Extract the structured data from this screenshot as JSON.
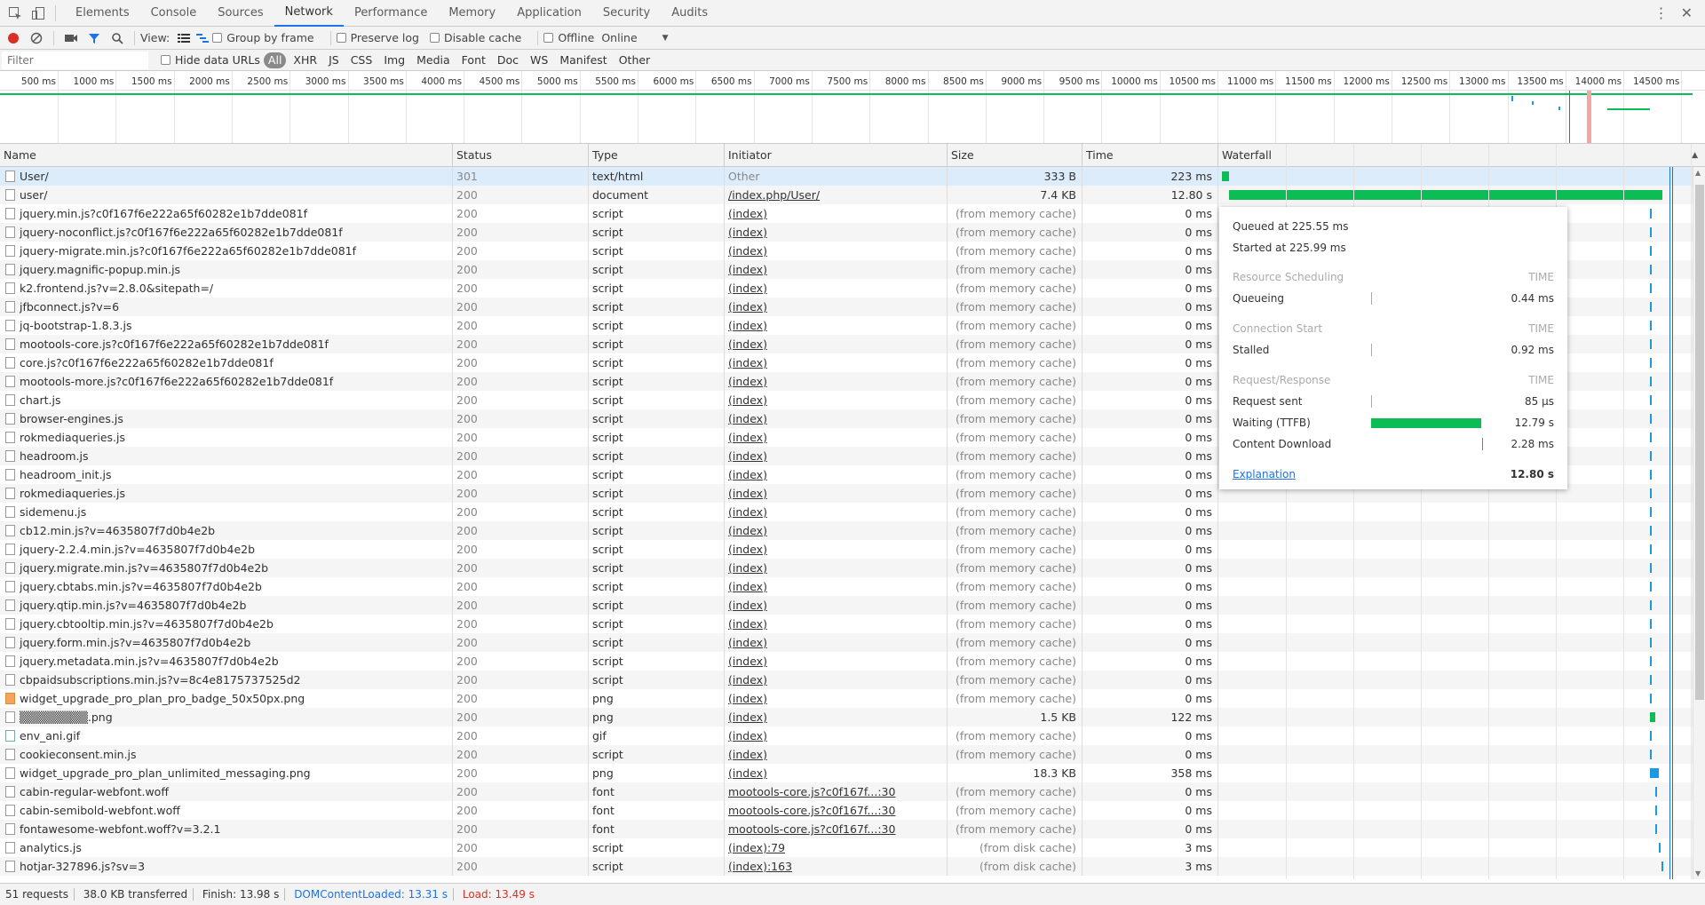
{
  "tabs": [
    "Elements",
    "Console",
    "Sources",
    "Network",
    "Performance",
    "Memory",
    "Application",
    "Security",
    "Audits"
  ],
  "active_tab": "Network",
  "toolbar": {
    "view_label": "View:",
    "group_by_frame": "Group by frame",
    "preserve_log": "Preserve log",
    "disable_cache": "Disable cache",
    "offline": "Offline",
    "throttle": "Online"
  },
  "filter": {
    "placeholder": "Filter",
    "hide_data_urls": "Hide data URLs",
    "types": [
      "All",
      "XHR",
      "JS",
      "CSS",
      "Img",
      "Media",
      "Font",
      "Doc",
      "WS",
      "Manifest",
      "Other"
    ]
  },
  "overview_ticks": [
    "500 ms",
    "1000 ms",
    "1500 ms",
    "2000 ms",
    "2500 ms",
    "3000 ms",
    "3500 ms",
    "4000 ms",
    "4500 ms",
    "5000 ms",
    "5500 ms",
    "6000 ms",
    "6500 ms",
    "7000 ms",
    "7500 ms",
    "8000 ms",
    "8500 ms",
    "9000 ms",
    "9500 ms",
    "10000 ms",
    "10500 ms",
    "11000 ms",
    "11500 ms",
    "12000 ms",
    "12500 ms",
    "13000 ms",
    "13500 ms",
    "14000 ms",
    "14500 ms"
  ],
  "columns": {
    "name": "Name",
    "status": "Status",
    "type": "Type",
    "initiator": "Initiator",
    "size": "Size",
    "time": "Time",
    "waterfall": "Waterfall"
  },
  "rows": [
    {
      "name": "User/",
      "status": "301",
      "type": "text/html",
      "initiator": "Other",
      "size": "333 B",
      "time": "223 ms",
      "icon": "doc"
    },
    {
      "name": "user/",
      "status": "200",
      "type": "document",
      "initiator": "/index.php/User/",
      "size": "7.4 KB",
      "time": "12.80 s",
      "icon": "doc"
    },
    {
      "name": "jquery.min.js?c0f167f6e222a65f60282e1b7dde081f",
      "status": "200",
      "type": "script",
      "initiator": "(index)",
      "size": "(from memory cache)",
      "time": "0 ms",
      "icon": "doc"
    },
    {
      "name": "jquery-noconflict.js?c0f167f6e222a65f60282e1b7dde081f",
      "status": "200",
      "type": "script",
      "initiator": "(index)",
      "size": "(from memory cache)",
      "time": "0 ms",
      "icon": "doc"
    },
    {
      "name": "jquery-migrate.min.js?c0f167f6e222a65f60282e1b7dde081f",
      "status": "200",
      "type": "script",
      "initiator": "(index)",
      "size": "(from memory cache)",
      "time": "0 ms",
      "icon": "doc"
    },
    {
      "name": "jquery.magnific-popup.min.js",
      "status": "200",
      "type": "script",
      "initiator": "(index)",
      "size": "(from memory cache)",
      "time": "0 ms",
      "icon": "doc"
    },
    {
      "name": "k2.frontend.js?v=2.8.0&sitepath=/",
      "status": "200",
      "type": "script",
      "initiator": "(index)",
      "size": "(from memory cache)",
      "time": "0 ms",
      "icon": "doc"
    },
    {
      "name": "jfbconnect.js?v=6",
      "status": "200",
      "type": "script",
      "initiator": "(index)",
      "size": "(from memory cache)",
      "time": "0 ms",
      "icon": "doc"
    },
    {
      "name": "jq-bootstrap-1.8.3.js",
      "status": "200",
      "type": "script",
      "initiator": "(index)",
      "size": "(from memory cache)",
      "time": "0 ms",
      "icon": "doc"
    },
    {
      "name": "mootools-core.js?c0f167f6e222a65f60282e1b7dde081f",
      "status": "200",
      "type": "script",
      "initiator": "(index)",
      "size": "(from memory cache)",
      "time": "0 ms",
      "icon": "doc"
    },
    {
      "name": "core.js?c0f167f6e222a65f60282e1b7dde081f",
      "status": "200",
      "type": "script",
      "initiator": "(index)",
      "size": "(from memory cache)",
      "time": "0 ms",
      "icon": "doc"
    },
    {
      "name": "mootools-more.js?c0f167f6e222a65f60282e1b7dde081f",
      "status": "200",
      "type": "script",
      "initiator": "(index)",
      "size": "(from memory cache)",
      "time": "0 ms",
      "icon": "doc"
    },
    {
      "name": "chart.js",
      "status": "200",
      "type": "script",
      "initiator": "(index)",
      "size": "(from memory cache)",
      "time": "0 ms",
      "icon": "doc"
    },
    {
      "name": "browser-engines.js",
      "status": "200",
      "type": "script",
      "initiator": "(index)",
      "size": "(from memory cache)",
      "time": "0 ms",
      "icon": "doc"
    },
    {
      "name": "rokmediaqueries.js",
      "status": "200",
      "type": "script",
      "initiator": "(index)",
      "size": "(from memory cache)",
      "time": "0 ms",
      "icon": "doc"
    },
    {
      "name": "headroom.js",
      "status": "200",
      "type": "script",
      "initiator": "(index)",
      "size": "(from memory cache)",
      "time": "0 ms",
      "icon": "doc"
    },
    {
      "name": "headroom_init.js",
      "status": "200",
      "type": "script",
      "initiator": "(index)",
      "size": "(from memory cache)",
      "time": "0 ms",
      "icon": "doc"
    },
    {
      "name": "rokmediaqueries.js",
      "status": "200",
      "type": "script",
      "initiator": "(index)",
      "size": "(from memory cache)",
      "time": "0 ms",
      "icon": "doc"
    },
    {
      "name": "sidemenu.js",
      "status": "200",
      "type": "script",
      "initiator": "(index)",
      "size": "(from memory cache)",
      "time": "0 ms",
      "icon": "doc"
    },
    {
      "name": "cb12.min.js?v=4635807f7d0b4e2b",
      "status": "200",
      "type": "script",
      "initiator": "(index)",
      "size": "(from memory cache)",
      "time": "0 ms",
      "icon": "doc"
    },
    {
      "name": "jquery-2.2.4.min.js?v=4635807f7d0b4e2b",
      "status": "200",
      "type": "script",
      "initiator": "(index)",
      "size": "(from memory cache)",
      "time": "0 ms",
      "icon": "doc"
    },
    {
      "name": "jquery.migrate.min.js?v=4635807f7d0b4e2b",
      "status": "200",
      "type": "script",
      "initiator": "(index)",
      "size": "(from memory cache)",
      "time": "0 ms",
      "icon": "doc"
    },
    {
      "name": "jquery.cbtabs.min.js?v=4635807f7d0b4e2b",
      "status": "200",
      "type": "script",
      "initiator": "(index)",
      "size": "(from memory cache)",
      "time": "0 ms",
      "icon": "doc"
    },
    {
      "name": "jquery.qtip.min.js?v=4635807f7d0b4e2b",
      "status": "200",
      "type": "script",
      "initiator": "(index)",
      "size": "(from memory cache)",
      "time": "0 ms",
      "icon": "doc"
    },
    {
      "name": "jquery.cbtooltip.min.js?v=4635807f7d0b4e2b",
      "status": "200",
      "type": "script",
      "initiator": "(index)",
      "size": "(from memory cache)",
      "time": "0 ms",
      "icon": "doc"
    },
    {
      "name": "jquery.form.min.js?v=4635807f7d0b4e2b",
      "status": "200",
      "type": "script",
      "initiator": "(index)",
      "size": "(from memory cache)",
      "time": "0 ms",
      "icon": "doc"
    },
    {
      "name": "jquery.metadata.min.js?v=4635807f7d0b4e2b",
      "status": "200",
      "type": "script",
      "initiator": "(index)",
      "size": "(from memory cache)",
      "time": "0 ms",
      "icon": "doc"
    },
    {
      "name": "cbpaidsubscriptions.min.js?v=8c4e8175737525d2",
      "status": "200",
      "type": "script",
      "initiator": "(index)",
      "size": "(from memory cache)",
      "time": "0 ms",
      "icon": "doc"
    },
    {
      "name": "widget_upgrade_pro_plan_pro_badge_50x50px.png",
      "status": "200",
      "type": "png",
      "initiator": "(index)",
      "size": "(from memory cache)",
      "time": "0 ms",
      "icon": "png"
    },
    {
      "name": "▒▒▒▒▒▒▒▒.png",
      "status": "200",
      "type": "png",
      "initiator": "(index)",
      "size": "1.5 KB",
      "time": "122 ms",
      "icon": "doc"
    },
    {
      "name": "env_ani.gif",
      "status": "200",
      "type": "gif",
      "initiator": "(index)",
      "size": "(from memory cache)",
      "time": "0 ms",
      "icon": "gif"
    },
    {
      "name": "cookieconsent.min.js",
      "status": "200",
      "type": "script",
      "initiator": "(index)",
      "size": "(from memory cache)",
      "time": "0 ms",
      "icon": "doc"
    },
    {
      "name": "widget_upgrade_pro_plan_unlimited_messaging.png",
      "status": "200",
      "type": "png",
      "initiator": "(index)",
      "size": "18.3 KB",
      "time": "358 ms",
      "icon": "doc"
    },
    {
      "name": "cabin-regular-webfont.woff",
      "status": "200",
      "type": "font",
      "initiator": "mootools-core.js?c0f167f...:30",
      "size": "(from memory cache)",
      "time": "0 ms",
      "icon": "doc"
    },
    {
      "name": "cabin-semibold-webfont.woff",
      "status": "200",
      "type": "font",
      "initiator": "mootools-core.js?c0f167f...:30",
      "size": "(from memory cache)",
      "time": "0 ms",
      "icon": "doc"
    },
    {
      "name": "fontawesome-webfont.woff?v=3.2.1",
      "status": "200",
      "type": "font",
      "initiator": "mootools-core.js?c0f167f...:30",
      "size": "(from memory cache)",
      "time": "0 ms",
      "icon": "doc"
    },
    {
      "name": "analytics.js",
      "status": "200",
      "type": "script",
      "initiator": "(index):79",
      "size": "(from disk cache)",
      "time": "3 ms",
      "icon": "doc"
    },
    {
      "name": "hotjar-327896.js?sv=3",
      "status": "200",
      "type": "script",
      "initiator": "(index):163",
      "size": "(from disk cache)",
      "time": "3 ms",
      "icon": "doc"
    }
  ],
  "timing": {
    "queued": "Queued at 225.55 ms",
    "started": "Started at 225.99 ms",
    "sections": [
      {
        "title": "Resource Scheduling",
        "col": "TIME",
        "items": [
          {
            "label": "Queueing",
            "value": "0.44 ms"
          }
        ]
      },
      {
        "title": "Connection Start",
        "col": "TIME",
        "items": [
          {
            "label": "Stalled",
            "value": "0.92 ms"
          }
        ]
      },
      {
        "title": "Request/Response",
        "col": "TIME",
        "items": [
          {
            "label": "Request sent",
            "value": "85 µs"
          },
          {
            "label": "Waiting (TTFB)",
            "value": "12.79 s"
          },
          {
            "label": "Content Download",
            "value": "2.28 ms"
          }
        ]
      }
    ],
    "explanation": "Explanation",
    "total": "12.80 s"
  },
  "status": {
    "requests": "51 requests",
    "transferred": "38.0 KB transferred",
    "finish": "Finish: 13.98 s",
    "dcl": "DOMContentLoaded: 13.31 s",
    "load": "Load: 13.49 s"
  },
  "colors": {
    "waiting": "#0cbd55",
    "dcl": "#1a73e8",
    "load": "#d93025",
    "active_tab": "#1a73e8"
  }
}
